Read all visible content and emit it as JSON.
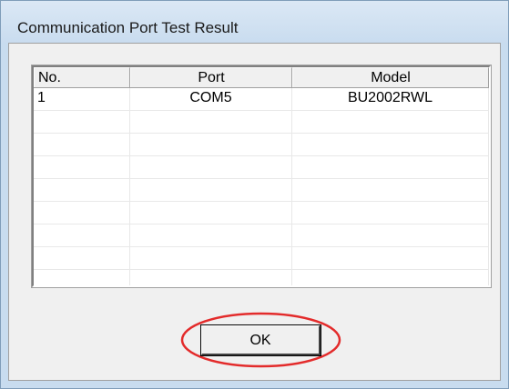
{
  "window": {
    "title": "Communication Port Test Result"
  },
  "table": {
    "columns": [
      "No.",
      "Port",
      "Model"
    ],
    "rows": [
      [
        "1",
        "COM5",
        "BU2002RWL"
      ],
      [
        "",
        "",
        ""
      ],
      [
        "",
        "",
        ""
      ],
      [
        "",
        "",
        ""
      ],
      [
        "",
        "",
        ""
      ],
      [
        "",
        "",
        ""
      ],
      [
        "",
        "",
        ""
      ],
      [
        "",
        "",
        ""
      ],
      [
        "",
        "",
        ""
      ]
    ]
  },
  "buttons": {
    "ok_label": "OK"
  },
  "colors": {
    "title_bar": "#c9dcef",
    "dialog_body": "#f0f0f0",
    "annotation_circle": "#e32b2b"
  }
}
